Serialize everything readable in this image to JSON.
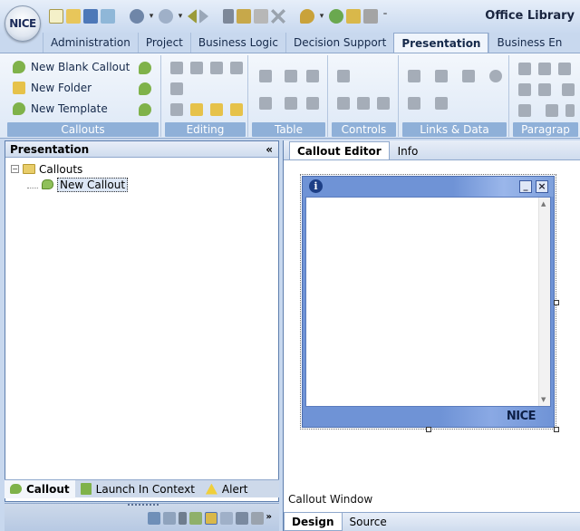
{
  "app": {
    "logo_text": "NICE",
    "title": "Office Library",
    "quick_access_icons": [
      "new-icon",
      "open-icon",
      "save-icon",
      "checkin-icon",
      "undo-icon",
      "redo-icon",
      "back-icon",
      "forward-icon",
      "cut-icon",
      "copy-icon",
      "paste-icon",
      "delete-icon",
      "find-icon",
      "play-icon",
      "publish-icon",
      "screenshot-icon"
    ]
  },
  "tabs": [
    {
      "label": "Administration"
    },
    {
      "label": "Project"
    },
    {
      "label": "Business Logic"
    },
    {
      "label": "Decision Support"
    },
    {
      "label": "Presentation",
      "active": true
    },
    {
      "label": "Business En"
    }
  ],
  "ribbon": {
    "groups": [
      {
        "label": "Callouts"
      },
      {
        "label": "Editing"
      },
      {
        "label": "Table"
      },
      {
        "label": "Controls"
      },
      {
        "label": "Links & Data"
      },
      {
        "label": "Paragrap"
      }
    ],
    "callouts_buttons": [
      {
        "label": "New Blank Callout",
        "icon": "callout-icon"
      },
      {
        "label": "New Folder",
        "icon": "folder-icon"
      },
      {
        "label": "New Template",
        "icon": "template-icon"
      }
    ]
  },
  "left_panel": {
    "title": "Presentation",
    "collapse_glyph": "«",
    "tree": {
      "expander": "−",
      "folder_label": "Callouts",
      "item_label": "New Callout"
    },
    "bottom_tabs": [
      {
        "label": "Callout",
        "active": true
      },
      {
        "label": "Launch In Context"
      },
      {
        "label": "Alert"
      }
    ],
    "more_glyph": "»"
  },
  "editor": {
    "tabs": [
      {
        "label": "Callout Editor",
        "active": true
      },
      {
        "label": "Info"
      }
    ],
    "callout_window": {
      "info_glyph": "i",
      "minimize_glyph": "_",
      "close_glyph": "×",
      "logo_text": "NICE"
    },
    "window_label": "Callout Window",
    "view_tabs": [
      {
        "label": "Design",
        "active": true
      },
      {
        "label": "Source"
      }
    ]
  },
  "colors": {
    "accent": "#8fb0d8",
    "window_frame": "#6f93d6",
    "tree_selection": "#dde7f5"
  }
}
